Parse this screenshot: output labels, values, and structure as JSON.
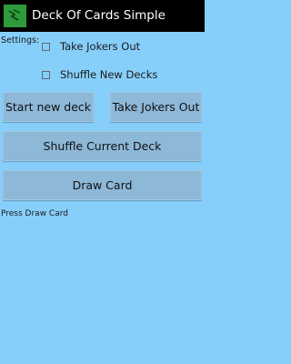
{
  "app": {
    "title": "Deck Of Cards Simple",
    "icon": "app-cards-icon",
    "accent_color": "#2f9a3c"
  },
  "settings": {
    "label": "Settings:",
    "options": [
      {
        "label": "Take Jokers Out",
        "checked": false
      },
      {
        "label": "Shuffle New Decks",
        "checked": false
      }
    ]
  },
  "buttons": {
    "start_new_deck": "Start new deck",
    "take_jokers_out": "Take Jokers Out",
    "shuffle_current_deck": "Shuffle Current Deck",
    "draw_card": "Draw Card"
  },
  "status": {
    "message": "Press Draw Card"
  },
  "colors": {
    "background": "#87cffb",
    "button": "#8db8d8",
    "action_bar": "#000000"
  }
}
